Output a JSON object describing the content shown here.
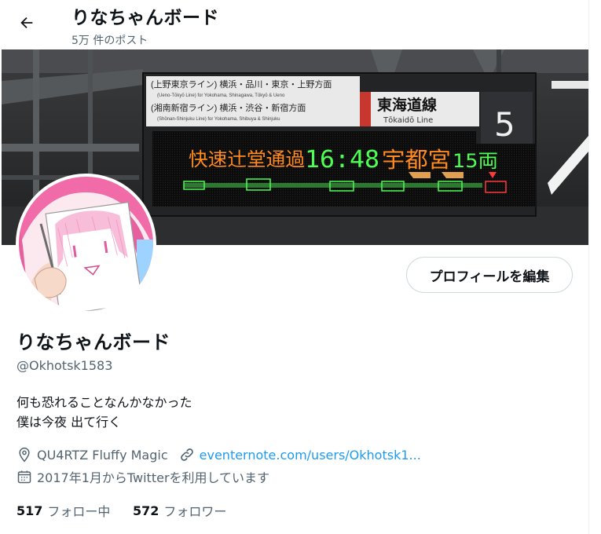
{
  "header": {
    "title": "りなちゃんボード",
    "post_count": "5万 件のポスト"
  },
  "banner": {
    "board_line1": "(上野東京ライン) 横浜・品川・東京・上野方面",
    "board_line1_en": "(Ueno-Tōkyō Line) for Yokohama, Shinagawa, Tōkyō & Ueno",
    "board_line2": "(湘南新宿ライン) 横浜・渋谷・新宿方面",
    "board_line2_en": "(Shōnan-Shinjuku Line) for Yokohama, Shibuya & Shinjuku",
    "line_name": "東海道線",
    "line_name_en": "Tōkaidō Line",
    "platform": "5",
    "led_type": "快速辻堂通過",
    "led_time": "16:48",
    "led_dest": "宇都宮",
    "led_cars": "15両"
  },
  "profile": {
    "edit_button": "プロフィールを編集",
    "name": "りなちゃんボード",
    "handle": "@Okhotsk1583",
    "bio_line1": "何も恐れることなんかなかった",
    "bio_line2": "僕は今夜 出て行く",
    "location": "QU4RTZ Fluffy Magic",
    "website": "eventernote.com/users/Okhotsk1...",
    "joined": "2017年1月からTwitterを利用しています"
  },
  "stats": {
    "following_count": "517",
    "following_label": "フォロー中",
    "followers_count": "572",
    "followers_label": "フォロワー"
  },
  "colors": {
    "accent": "#1d9bf0",
    "secondary_text": "#536471",
    "led_orange": "#ff8a1e",
    "led_green": "#4cff52",
    "line_red": "#c8372d"
  }
}
